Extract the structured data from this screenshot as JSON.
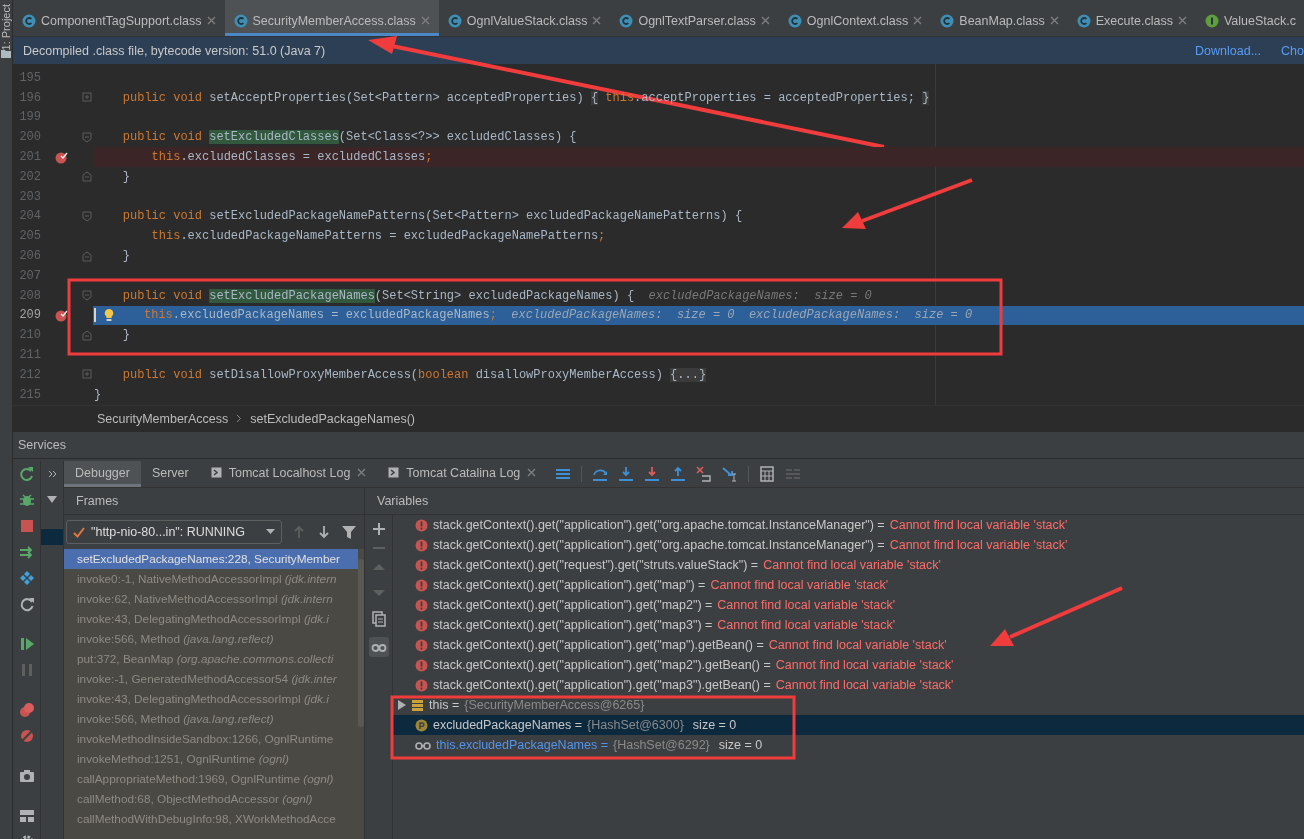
{
  "sidebar_strip": {
    "label": "1: Project"
  },
  "editor_tabs": [
    {
      "label": "ComponentTagSupport.class",
      "kind": "class",
      "selected": false
    },
    {
      "label": "SecurityMemberAccess.class",
      "kind": "class",
      "selected": true
    },
    {
      "label": "OgnlValueStack.class",
      "kind": "class",
      "selected": false
    },
    {
      "label": "OgnlTextParser.class",
      "kind": "class",
      "selected": false
    },
    {
      "label": "OgnlContext.class",
      "kind": "class",
      "selected": false
    },
    {
      "label": "BeanMap.class",
      "kind": "class",
      "selected": false
    },
    {
      "label": "Execute.class",
      "kind": "class",
      "selected": false
    },
    {
      "label": "ValueStack.c",
      "kind": "interface",
      "selected": false
    }
  ],
  "banner": {
    "text": "Decompiled .class file, bytecode version: 51.0 (Java 7)",
    "links": [
      "Download...",
      "Cho"
    ]
  },
  "code_lines": [
    {
      "number": "195",
      "kind": "plain",
      "breakpoint": false,
      "current": false
    },
    {
      "number": "196",
      "kind": "folded",
      "breakpoint": false,
      "current": false,
      "tokens": [
        {
          "text": "    public void ",
          "kind": "kw"
        },
        {
          "text": "setAcceptProperties(Set<Pattern> acceptedProperties) ",
          "kind": "text"
        },
        {
          "text": "{",
          "kind": "folded"
        },
        {
          "text": " this",
          "kind": "kw"
        },
        {
          "text": ".acceptProperties = acceptedProperties; ",
          "kind": "text"
        },
        {
          "text": "}",
          "kind": "folded"
        }
      ]
    },
    {
      "number": "199",
      "kind": "plain",
      "breakpoint": false,
      "current": false
    },
    {
      "number": "200",
      "kind": "fold_start",
      "breakpoint": false,
      "current": false,
      "tokens": [
        {
          "text": "    public void ",
          "kind": "kw"
        },
        {
          "text": "setExcludedClasses",
          "kind": "decl"
        },
        {
          "text": "(Set<Class<?>> excludedClasses) {",
          "kind": "text"
        }
      ]
    },
    {
      "number": "201",
      "kind": "plain",
      "breakpoint": true,
      "current": false,
      "tokens": [
        {
          "text": "        this",
          "kind": "kw"
        },
        {
          "text": ".excludedClasses = excludedClasses",
          "kind": "text"
        },
        {
          "text": ";",
          "kind": "kw"
        }
      ]
    },
    {
      "number": "202",
      "kind": "fold_end",
      "breakpoint": false,
      "current": false,
      "tokens": [
        {
          "text": "    }",
          "kind": "text"
        }
      ]
    },
    {
      "number": "203",
      "kind": "plain",
      "breakpoint": false,
      "current": false
    },
    {
      "number": "204",
      "kind": "fold_start",
      "breakpoint": false,
      "current": false,
      "tokens": [
        {
          "text": "    public void ",
          "kind": "kw"
        },
        {
          "text": "setExcludedPackageNamePatterns(Set<Pattern> excludedPackageNamePatterns) {",
          "kind": "text"
        }
      ]
    },
    {
      "number": "205",
      "kind": "plain",
      "breakpoint": false,
      "current": false,
      "tokens": [
        {
          "text": "        this",
          "kind": "kw"
        },
        {
          "text": ".excludedPackageNamePatterns = excludedPackageNamePatterns",
          "kind": "text"
        },
        {
          "text": ";",
          "kind": "kw"
        }
      ]
    },
    {
      "number": "206",
      "kind": "fold_end",
      "breakpoint": false,
      "current": false,
      "tokens": [
        {
          "text": "    }",
          "kind": "text"
        }
      ]
    },
    {
      "number": "207",
      "kind": "plain",
      "breakpoint": false,
      "current": false
    },
    {
      "number": "208",
      "kind": "fold_start",
      "breakpoint": false,
      "current": false,
      "tokens": [
        {
          "text": "    public void ",
          "kind": "kw"
        },
        {
          "text": "setExcludedPackageNames",
          "kind": "decl"
        },
        {
          "text": "(Set<String> excludedPackageNames) {  ",
          "kind": "text"
        },
        {
          "text": "excludedPackageNames:  size = 0",
          "kind": "hint"
        }
      ]
    },
    {
      "number": "209",
      "kind": "plain",
      "breakpoint": true,
      "current": true,
      "tokens": [
        {
          "text": "    this",
          "kind": "kw"
        },
        {
          "text": ".excludedPackageNames = excludedPackageNames",
          "kind": "text"
        },
        {
          "text": ";  ",
          "kind": "kw"
        },
        {
          "text": "excludedPackageNames:  size = 0  ",
          "kind": "hint"
        },
        {
          "text": "excludedPackageNames:  size = 0",
          "kind": "hint"
        }
      ]
    },
    {
      "number": "210",
      "kind": "fold_end",
      "breakpoint": false,
      "current": false,
      "tokens": [
        {
          "text": "    }",
          "kind": "text"
        }
      ]
    },
    {
      "number": "211",
      "kind": "plain",
      "breakpoint": false,
      "current": false
    },
    {
      "number": "212",
      "kind": "folded",
      "breakpoint": false,
      "current": false,
      "tokens": [
        {
          "text": "    public void ",
          "kind": "kw"
        },
        {
          "text": "setDisallowProxyMemberAccess(",
          "kind": "text"
        },
        {
          "text": "boolean ",
          "kind": "kw"
        },
        {
          "text": "disallowProxyMemberAccess) ",
          "kind": "text"
        },
        {
          "text": "{...}",
          "kind": "folded"
        }
      ]
    },
    {
      "number": "215",
      "kind": "plain",
      "breakpoint": false,
      "current": false,
      "tokens": [
        {
          "text": "}",
          "kind": "text"
        }
      ]
    }
  ],
  "breadcrumb": [
    "SecurityMemberAccess",
    "setExcludedPackageNames()"
  ],
  "services": {
    "title": "Services",
    "tabs": [
      {
        "label": "Debugger",
        "console": false,
        "closable": false,
        "selected": true
      },
      {
        "label": "Server",
        "console": false,
        "closable": false,
        "selected": false
      },
      {
        "label": "Tomcat Localhost Log",
        "console": true,
        "closable": true,
        "selected": false
      },
      {
        "label": "Tomcat Catalina Log",
        "console": true,
        "closable": true,
        "selected": false
      }
    ]
  },
  "frames": {
    "title": "Frames",
    "thread": "\"http-nio-80...in\": RUNNING",
    "items": [
      {
        "text": "setExcludedPackageNames:228, SecurityMember",
        "selected": true
      },
      {
        "text": "invoke0:-1, NativeMethodAccessorImpl *(jdk.intern*",
        "selected": false
      },
      {
        "text": "invoke:62, NativeMethodAccessorImpl *(jdk.intern*",
        "selected": false
      },
      {
        "text": "invoke:43, DelegatingMethodAccessorImpl *(jdk.i*",
        "selected": false
      },
      {
        "text": "invoke:566, Method *(java.lang.reflect)*",
        "selected": false
      },
      {
        "text": "put:372, BeanMap *(org.apache.commons.collecti*",
        "selected": false
      },
      {
        "text": "invoke:-1, GeneratedMethodAccessor54 *(jdk.inter*",
        "selected": false
      },
      {
        "text": "invoke:43, DelegatingMethodAccessorImpl *(jdk.i*",
        "selected": false
      },
      {
        "text": "invoke:566, Method *(java.lang.reflect)*",
        "selected": false
      },
      {
        "text": "invokeMethodInsideSandbox:1266, OgnlRuntime",
        "selected": false
      },
      {
        "text": "invokeMethod:1251, OgnlRuntime *(ognl)*",
        "selected": false
      },
      {
        "text": "callAppropriateMethod:1969, OgnlRuntime *(ognl)*",
        "selected": false
      },
      {
        "text": "callMethod:68, ObjectMethodAccessor *(ognl)*",
        "selected": false
      },
      {
        "text": "callMethodWithDebugInfo:98, XWorkMethodAcce",
        "selected": false
      }
    ]
  },
  "variables": {
    "title": "Variables",
    "items": [
      {
        "kind": "error",
        "name": "stack.getContext().get(\"application\").get(\"org.apache.tomcat.InstanceManager\") =",
        "value": "Cannot find local variable 'stack'",
        "selected": false
      },
      {
        "kind": "error",
        "name": "stack.getContext().get(\"application\").get(\"org.apache.tomcat.InstanceManager\") =",
        "value": "Cannot find local variable 'stack'",
        "selected": false
      },
      {
        "kind": "error",
        "name": "stack.getContext().get(\"request\").get(\"struts.valueStack\") =",
        "value": "Cannot find local variable 'stack'",
        "selected": false
      },
      {
        "kind": "error",
        "name": "stack.getContext().get(\"application\").get(\"map\") =",
        "value": "Cannot find local variable 'stack'",
        "selected": false
      },
      {
        "kind": "error",
        "name": "stack.getContext().get(\"application\").get(\"map2\") =",
        "value": "Cannot find local variable 'stack'",
        "selected": false
      },
      {
        "kind": "error",
        "name": "stack.getContext().get(\"application\").get(\"map3\") =",
        "value": "Cannot find local variable 'stack'",
        "selected": false
      },
      {
        "kind": "error",
        "name": "stack.getContext().get(\"application\").get(\"map\").getBean() =",
        "value": "Cannot find local variable 'stack'",
        "selected": false
      },
      {
        "kind": "error",
        "name": "stack.getContext().get(\"application\").get(\"map2\").getBean() =",
        "value": "Cannot find local variable 'stack'",
        "selected": false
      },
      {
        "kind": "error",
        "name": "stack.getContext().get(\"application\").get(\"map3\").getBean() =",
        "value": "Cannot find local variable 'stack'",
        "selected": false
      },
      {
        "kind": "object",
        "name": "this =",
        "value": "{SecurityMemberAccess@6265}",
        "selected": false
      },
      {
        "kind": "param",
        "name": "excludedPackageNames =",
        "value": "{HashSet@6300}",
        "extra": "size = 0",
        "selected": true
      },
      {
        "kind": "watch",
        "name": "this.excludedPackageNames =",
        "value": "{HashSet@6292}",
        "extra": "size = 0",
        "selected": false
      }
    ]
  }
}
